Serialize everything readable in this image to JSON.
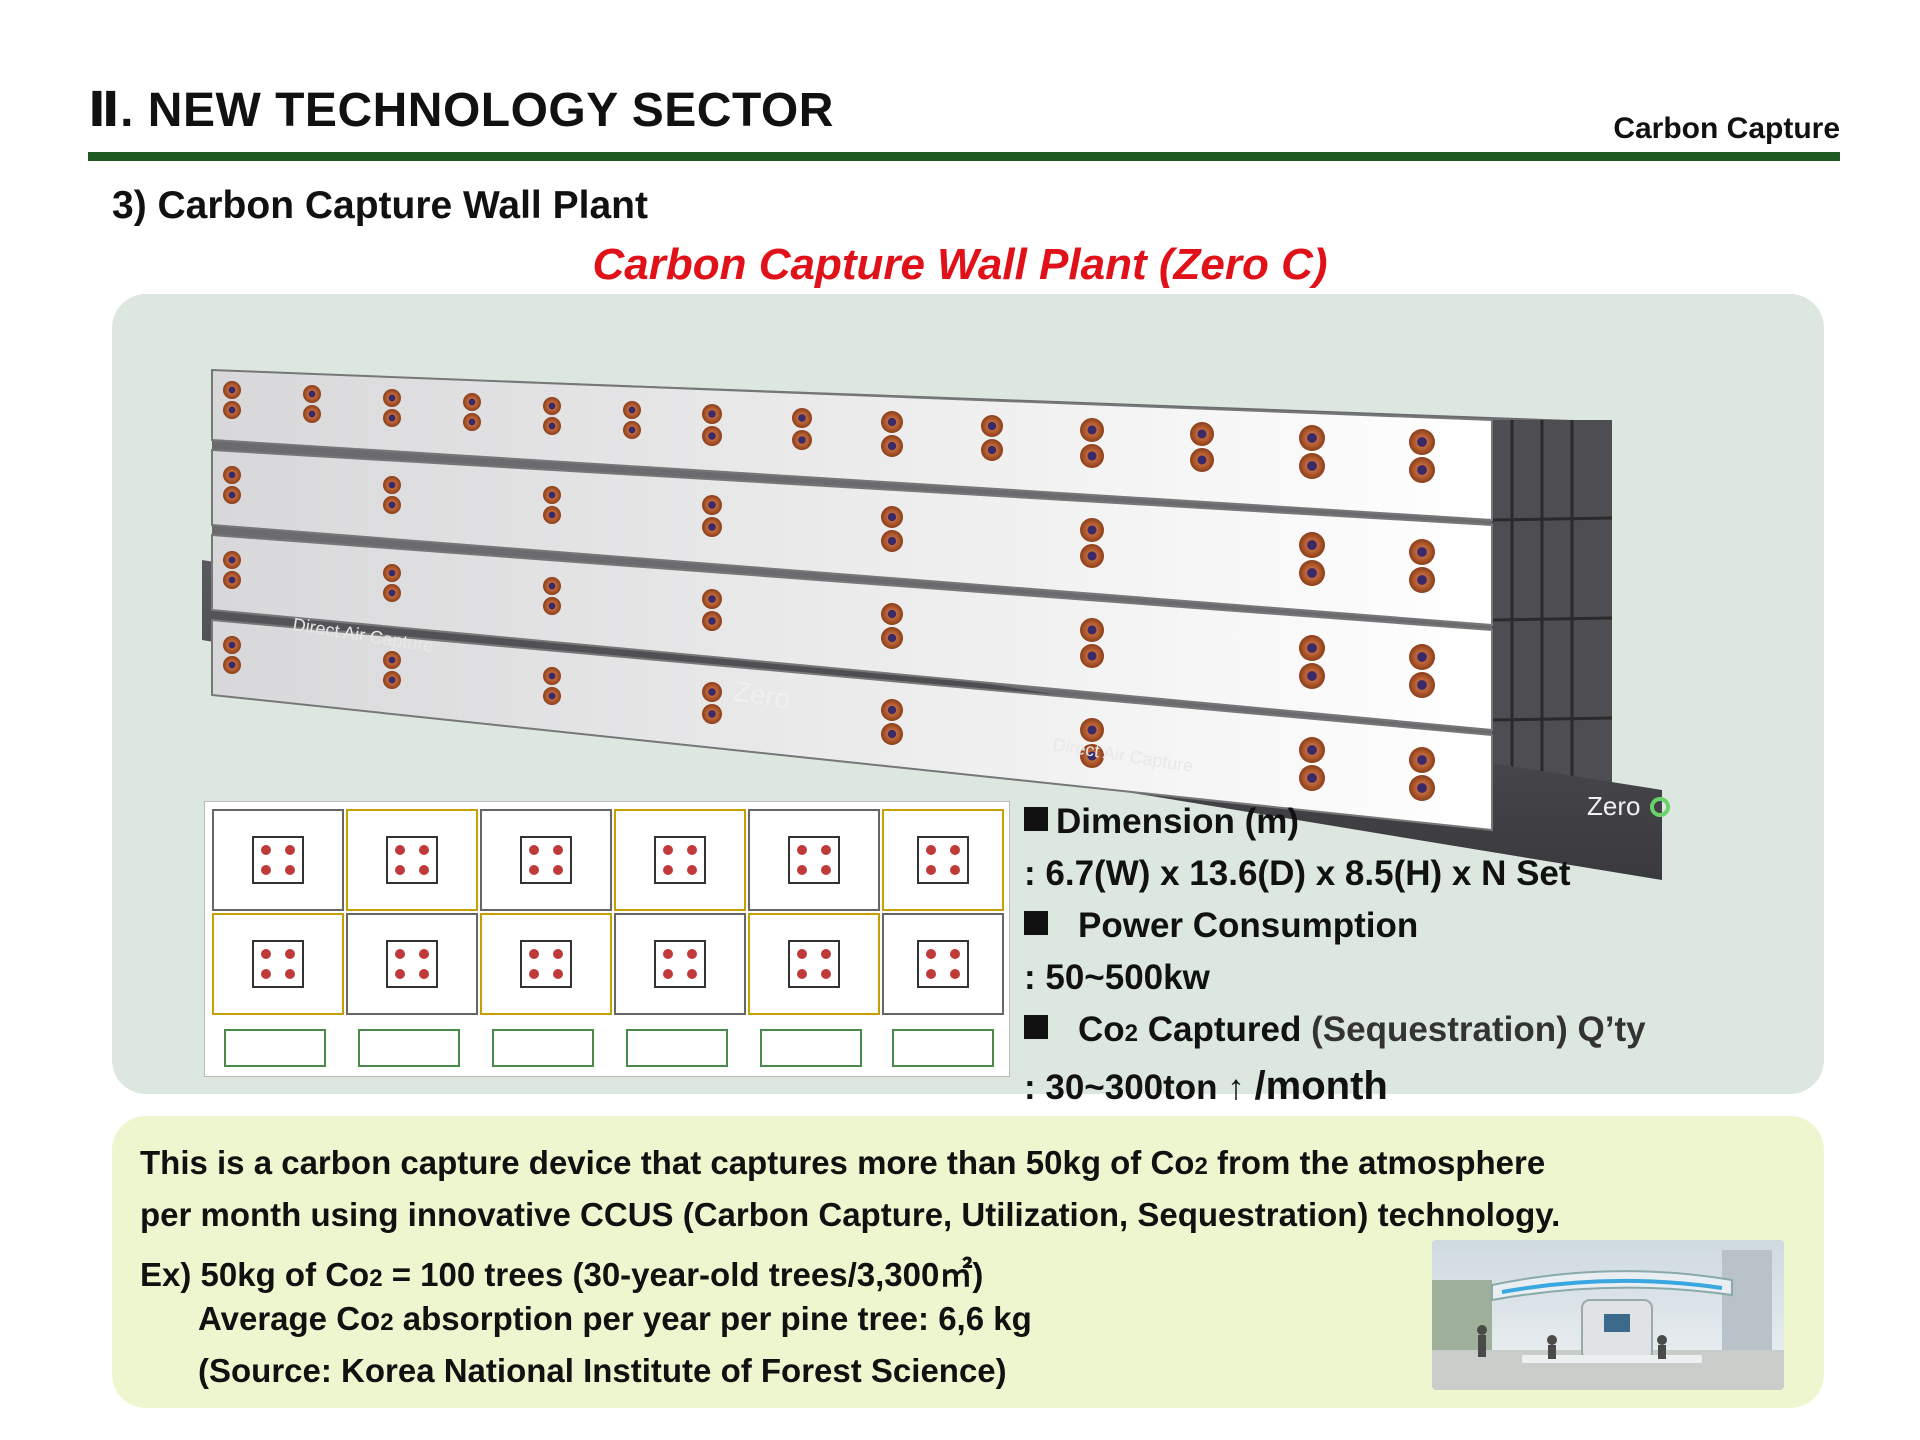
{
  "header": {
    "section_title": "Ⅱ. NEW TECHNOLOGY SECTOR",
    "section_tag": "Carbon Capture"
  },
  "subtitle": "3) Carbon Capture Wall Plant",
  "main_title": "Carbon Capture Wall Plant (Zero C)",
  "render": {
    "label_direct_air_1": "Direct Air Capture",
    "label_direct_air_2": "Direct Air Capture",
    "brand_1": "Zero",
    "brand_2": "Zero"
  },
  "specs": {
    "dimension_label": "Dimension (m)",
    "dimension_value": ": 6.7(W) x 13.6(D) x 8.5(H) x N Set",
    "power_label": "Power Consumption",
    "power_value": ": 50~500kw",
    "co2_label_a": "Co",
    "co2_label_sub": "2",
    "co2_label_b": " Captured",
    "co2_label_c": " (Sequestration) Q’ty",
    "co2_value_a": ": 30~300ton ↑ ",
    "co2_value_b": "/month"
  },
  "description": {
    "line1_a": "This is a carbon capture device that captures more than 50kg of Co",
    "line1_sub": "2",
    "line1_b": " from the atmosphere",
    "line2": "per month using innovative CCUS (Carbon Capture, Utilization, Sequestration) technology.",
    "line3_a": "Ex) 50kg of Co",
    "line3_sub": "2",
    "line3_b": " = 100 trees (30-year-old trees/3,300㎡)",
    "line4_a": "Average Co",
    "line4_sub": "2",
    "line4_b": " absorption per year per pine tree: 6,6 kg",
    "line5": "(Source: Korea National Institute of Forest Science)"
  },
  "colors": {
    "rule_green": "#1e5a22",
    "title_red": "#e1111a",
    "panel_bg": "#dce7e0",
    "desc_bg": "#eef6cf"
  }
}
